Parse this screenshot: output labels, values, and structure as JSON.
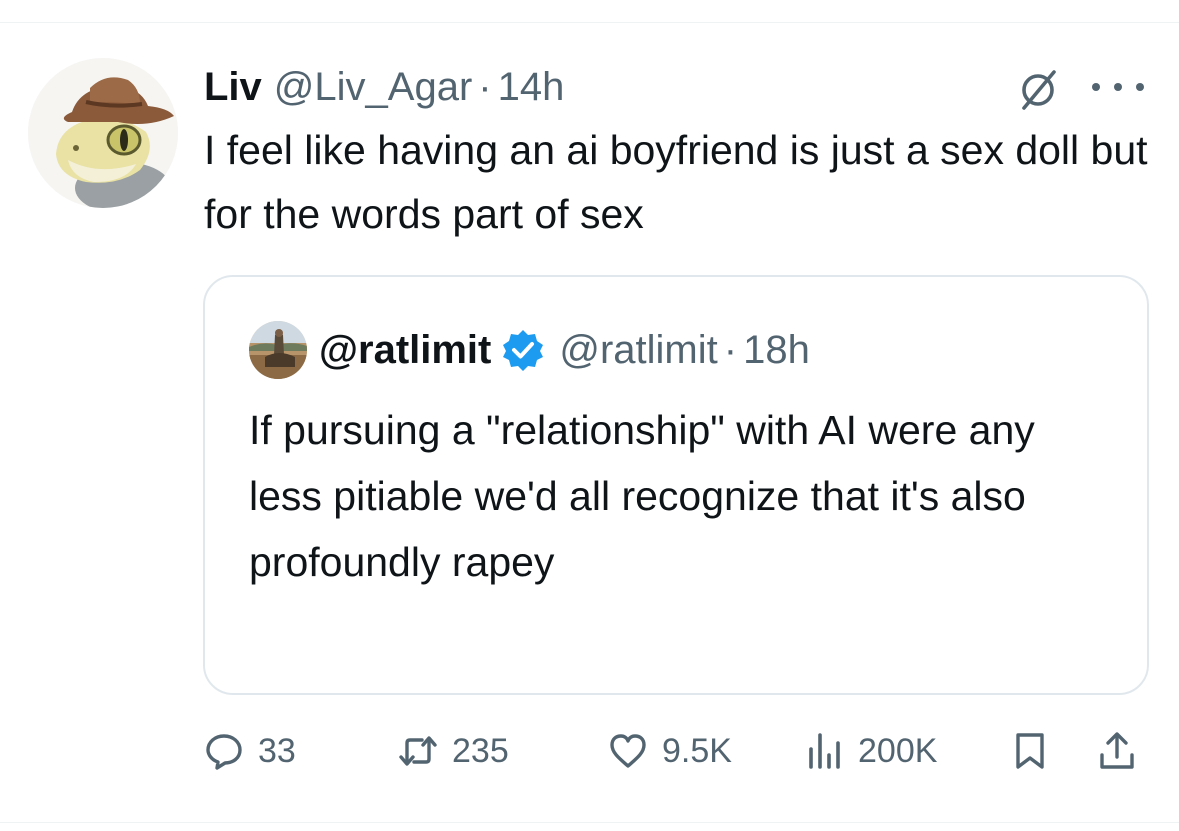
{
  "tweet": {
    "display_name": "Liv",
    "handle": "@Liv_Agar",
    "separator": "·",
    "time": "14h",
    "text": "I feel like having an ai boyfriend is just a sex doll but for the words part of sex"
  },
  "quote": {
    "display_name": "@ratlimit",
    "handle": "@ratlimit",
    "separator": "·",
    "time": "18h",
    "verified": true,
    "text": "If pursuing a \"relationship\" with AI were any less pitiable we'd all recognize that it's also profoundly rapey"
  },
  "actions": {
    "replies": "33",
    "reposts": "235",
    "likes": "9.5K",
    "views": "200K"
  },
  "icons": {
    "reply": "reply-icon",
    "repost": "repost-icon",
    "like": "heart-icon",
    "views": "views-icon",
    "bookmark": "bookmark-icon",
    "share": "share-icon",
    "grok": "grok-icon",
    "more": "more-icon",
    "verified": "verified-badge-icon"
  },
  "colors": {
    "text": "#0f1419",
    "secondary": "#536471",
    "verified": "#1d9bf0",
    "border": "#e1e8ed"
  }
}
